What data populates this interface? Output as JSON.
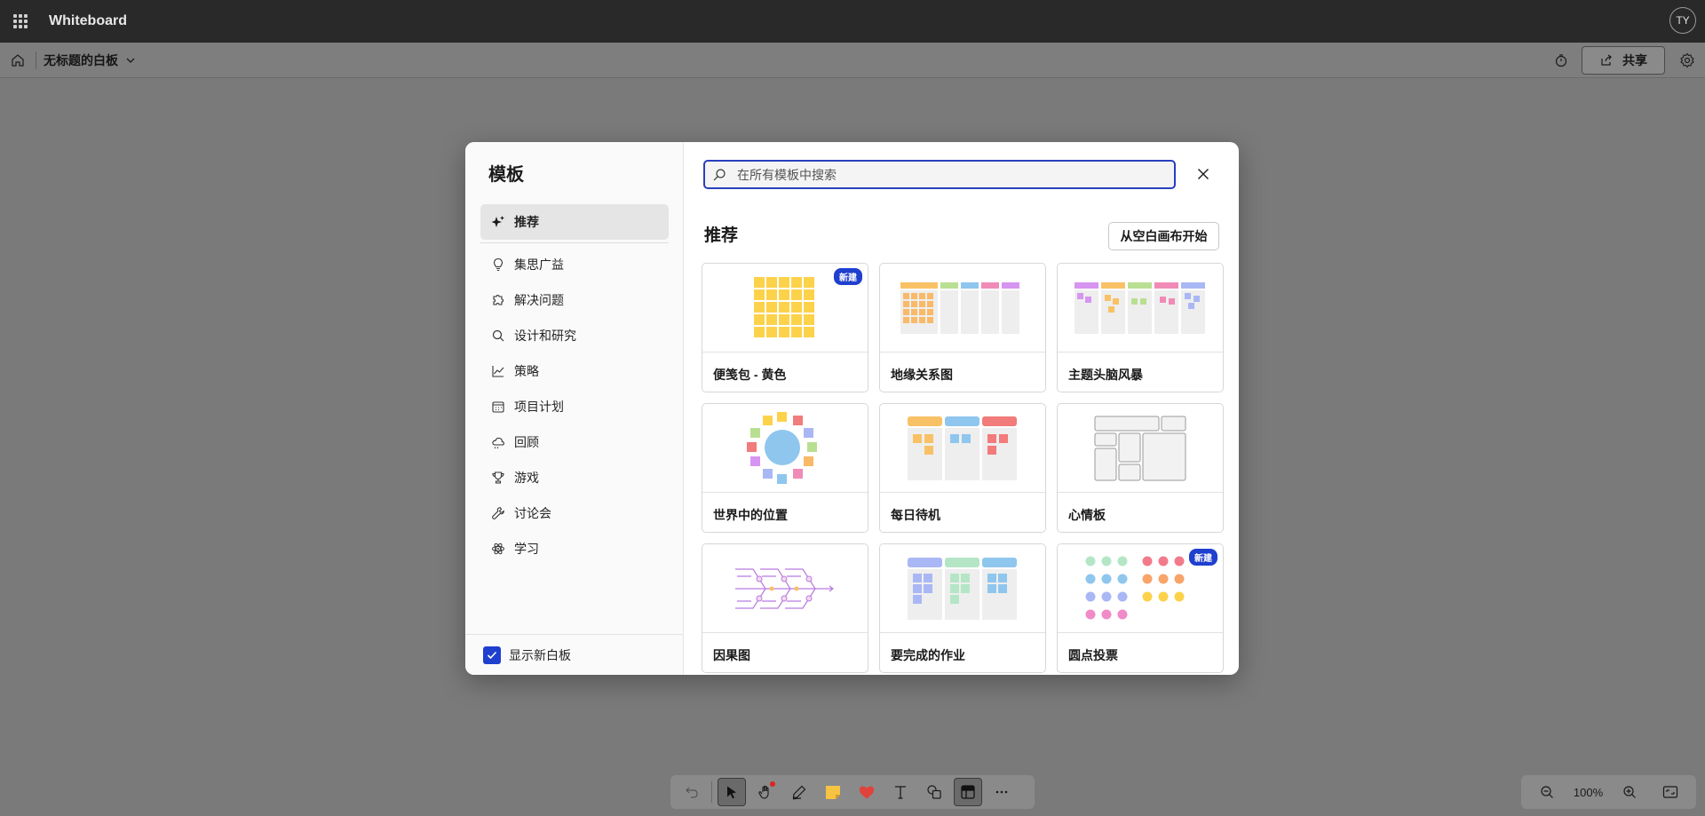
{
  "appbar": {
    "title": "Whiteboard",
    "avatar_initials": "TY"
  },
  "subbar": {
    "board_name": "无标题的白板",
    "share_label": "共享"
  },
  "dialog": {
    "title": "模板",
    "search_placeholder": "在所有模板中搜索",
    "section_title": "推荐",
    "blank_button": "从空白画布开始",
    "categories": [
      {
        "label": "推荐",
        "icon": "sparkle-icon"
      },
      {
        "label": "集思广益",
        "icon": "lightbulb-icon"
      },
      {
        "label": "解决问题",
        "icon": "puzzle-icon"
      },
      {
        "label": "设计和研究",
        "icon": "search-icon"
      },
      {
        "label": "策略",
        "icon": "chart-line-icon"
      },
      {
        "label": "项目计划",
        "icon": "calendar-icon"
      },
      {
        "label": "回顾",
        "icon": "cloud-icon"
      },
      {
        "label": "游戏",
        "icon": "trophy-icon"
      },
      {
        "label": "讨论会",
        "icon": "wrench-icon"
      },
      {
        "label": "学习",
        "icon": "atom-icon"
      }
    ],
    "show_new_label": "显示新白板",
    "badge_new": "新建",
    "templates": [
      {
        "label": "便笺包 - 黄色",
        "badge": true
      },
      {
        "label": "地缘关系图",
        "badge": false
      },
      {
        "label": "主题头脑风暴",
        "badge": false
      },
      {
        "label": "世界中的位置",
        "badge": false
      },
      {
        "label": "每日待机",
        "badge": false
      },
      {
        "label": "心情板",
        "badge": false
      },
      {
        "label": "因果图",
        "badge": false
      },
      {
        "label": "要完成的作业",
        "badge": false
      },
      {
        "label": "圆点投票",
        "badge": true
      }
    ]
  },
  "zoom": {
    "level": "100%"
  },
  "colors": {
    "accent": "#1f3fcf",
    "appbar": "#292929",
    "badge": "#1f3fcf"
  }
}
